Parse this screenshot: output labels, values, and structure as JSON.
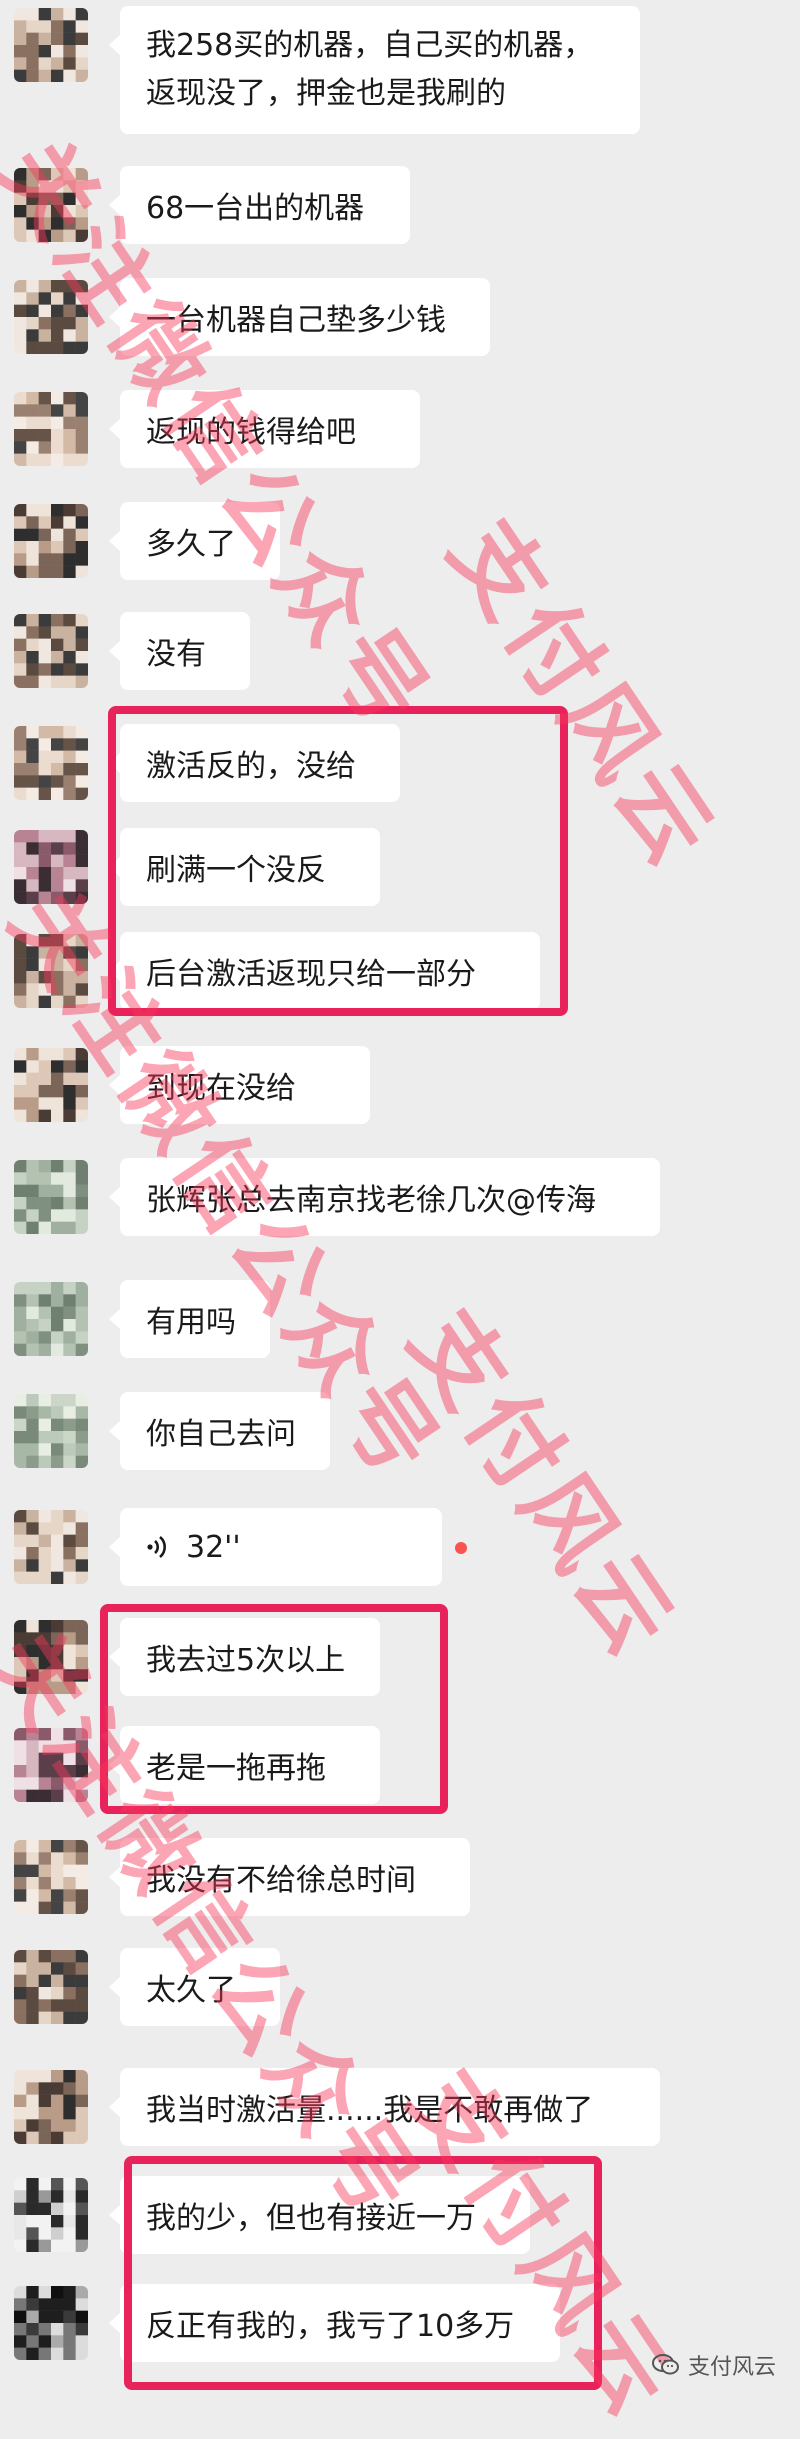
{
  "messages": [
    {
      "avatar": "pixelated-avatar",
      "lines": [
        "我258买的机器，自己买的机器，",
        "返现没了，押金也是我刷的"
      ]
    },
    {
      "avatar": "pixelated-avatar",
      "text": "68一台出的机器"
    },
    {
      "avatar": "pixelated-avatar",
      "text": "一台机器自己垫多少钱"
    },
    {
      "avatar": "pixelated-avatar",
      "text": "返现的钱得给吧"
    },
    {
      "avatar": "pixelated-avatar",
      "text": "多久了"
    },
    {
      "avatar": "pixelated-avatar",
      "text": "没有"
    },
    {
      "avatar": "pixelated-avatar",
      "text": "激活反的，没给"
    },
    {
      "avatar": "pixelated-avatar",
      "text": "刷满一个没反"
    },
    {
      "avatar": "pixelated-avatar",
      "text": "后台激活返现只给一部分"
    },
    {
      "avatar": "pixelated-avatar",
      "text": "到现在没给"
    },
    {
      "avatar": "pixelated-avatar-green",
      "text": "张辉张总去南京找老徐几次@传海"
    },
    {
      "avatar": "pixelated-avatar-green",
      "text": "有用吗"
    },
    {
      "avatar": "pixelated-avatar-green",
      "text": "你自己去问"
    },
    {
      "avatar": "pixelated-avatar",
      "voice": "32''"
    },
    {
      "avatar": "pixelated-avatar",
      "text": "我去过5次以上"
    },
    {
      "avatar": "pixelated-avatar",
      "text": "老是一拖再拖"
    },
    {
      "avatar": "pixelated-avatar",
      "text": "我没有不给徐总时间"
    },
    {
      "avatar": "pixelated-avatar",
      "text": "太久了"
    },
    {
      "avatar": "pixelated-avatar",
      "text": "我当时激活量......我是不敢再做了"
    },
    {
      "avatar": "pixelated-avatar-dark",
      "text": "我的少，但也有接近一万"
    },
    {
      "avatar": "pixelated-avatar-dark2",
      "text": "反正有我的，我亏了10多万"
    }
  ],
  "watermark": {
    "follow_text": "关注微信公众号",
    "brand_text": "支付风云",
    "color": "#f6385a"
  },
  "highlight_color": "#e8225a",
  "footer": {
    "icon": "wechat-icon",
    "label": "支付风云"
  }
}
